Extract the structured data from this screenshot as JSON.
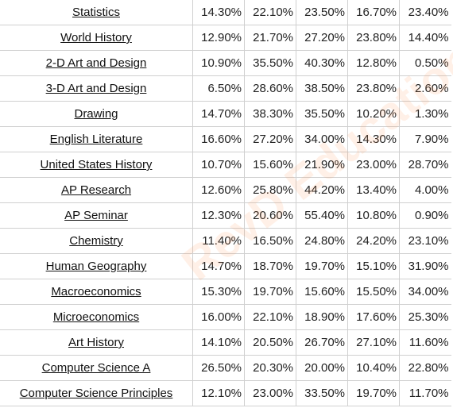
{
  "watermark": "RevD Education",
  "accent_watermark_color": "#ff8c46",
  "rows": [
    {
      "subject": "Statistics",
      "values": [
        "14.30%",
        "22.10%",
        "23.50%",
        "16.70%",
        "23.40%"
      ]
    },
    {
      "subject": "World History",
      "values": [
        "12.90%",
        "21.70%",
        "27.20%",
        "23.80%",
        "14.40%"
      ]
    },
    {
      "subject": "2-D Art and Design",
      "values": [
        "10.90%",
        "35.50%",
        "40.30%",
        "12.80%",
        "0.50%"
      ]
    },
    {
      "subject": "3-D Art and Design",
      "values": [
        "6.50%",
        "28.60%",
        "38.50%",
        "23.80%",
        "2.60%"
      ]
    },
    {
      "subject": "Drawing",
      "values": [
        "14.70%",
        "38.30%",
        "35.50%",
        "10.20%",
        "1.30%"
      ]
    },
    {
      "subject": "English Literature",
      "values": [
        "16.60%",
        "27.20%",
        "34.00%",
        "14.30%",
        "7.90%"
      ]
    },
    {
      "subject": "United States History",
      "values": [
        "10.70%",
        "15.60%",
        "21.90%",
        "23.00%",
        "28.70%"
      ]
    },
    {
      "subject": "AP Research",
      "values": [
        "12.60%",
        "25.80%",
        "44.20%",
        "13.40%",
        "4.00%"
      ]
    },
    {
      "subject": "AP Seminar",
      "values": [
        "12.30%",
        "20.60%",
        "55.40%",
        "10.80%",
        "0.90%"
      ]
    },
    {
      "subject": "Chemistry",
      "values": [
        "11.40%",
        "16.50%",
        "24.80%",
        "24.20%",
        "23.10%"
      ]
    },
    {
      "subject": "Human Geography",
      "values": [
        "14.70%",
        "18.70%",
        "19.70%",
        "15.10%",
        "31.90%"
      ]
    },
    {
      "subject": "Macroeconomics",
      "values": [
        "15.30%",
        "19.70%",
        "15.60%",
        "15.50%",
        "34.00%"
      ]
    },
    {
      "subject": "Microeconomics",
      "values": [
        "16.00%",
        "22.10%",
        "18.90%",
        "17.60%",
        "25.30%"
      ]
    },
    {
      "subject": "Art History",
      "values": [
        "14.10%",
        "20.50%",
        "26.70%",
        "27.10%",
        "11.60%"
      ]
    },
    {
      "subject": "Computer Science A",
      "values": [
        "26.50%",
        "20.30%",
        "20.00%",
        "10.40%",
        "22.80%"
      ]
    },
    {
      "subject": "Computer Science Principles",
      "values": [
        "12.10%",
        "23.00%",
        "33.50%",
        "19.70%",
        "11.70%"
      ]
    }
  ]
}
